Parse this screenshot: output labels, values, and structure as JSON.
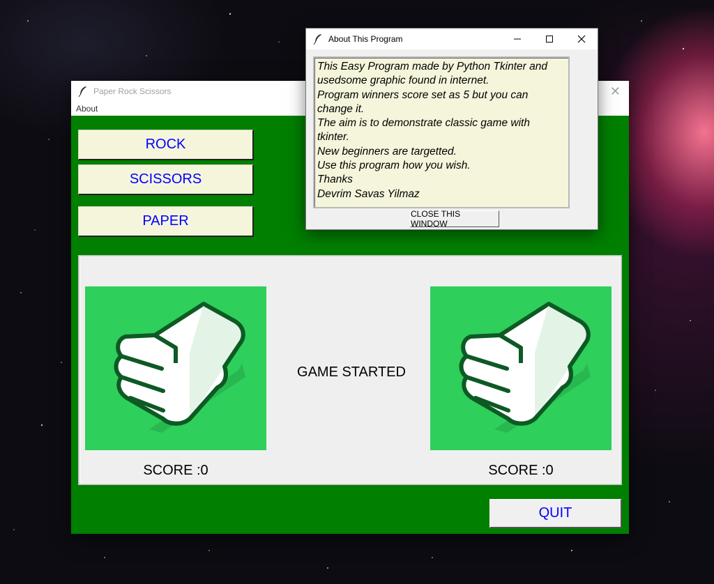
{
  "main_window": {
    "title": "Paper Rock Scissors",
    "menu_about": "About",
    "buttons": {
      "rock": "ROCK",
      "scissors": "SCISSORS",
      "paper": "PAPER",
      "quit": "QUIT"
    },
    "status": "GAME STARTED",
    "player_score": "SCORE :0",
    "computer_score": "SCORE :0"
  },
  "about_window": {
    "title": "About This Program",
    "lines": [
      "This Easy Program made by Python Tkinter and",
      "usedsome graphic found in internet.",
      "Program winners score set as 5 but you can",
      "change it.",
      "The aim is to demonstrate classic game with",
      "tkinter.",
      "New beginners are targetted.",
      "Use this program how you wish.",
      "Thanks",
      "Devrim Savas Yilmaz"
    ],
    "close_button": "CLOSE THIS WINDOW"
  },
  "icons": {
    "app": "feather-icon",
    "hand": "rock-fist-icon",
    "minimize": "minimize-icon",
    "maximize": "maximize-icon",
    "close": "close-icon"
  },
  "colors": {
    "window_bg": "#007f00",
    "button_bg": "#f5f5dc",
    "button_text": "#0000ff",
    "hand_tile": "#2ecf5a",
    "about_text_bg": "#f5f5dc"
  }
}
